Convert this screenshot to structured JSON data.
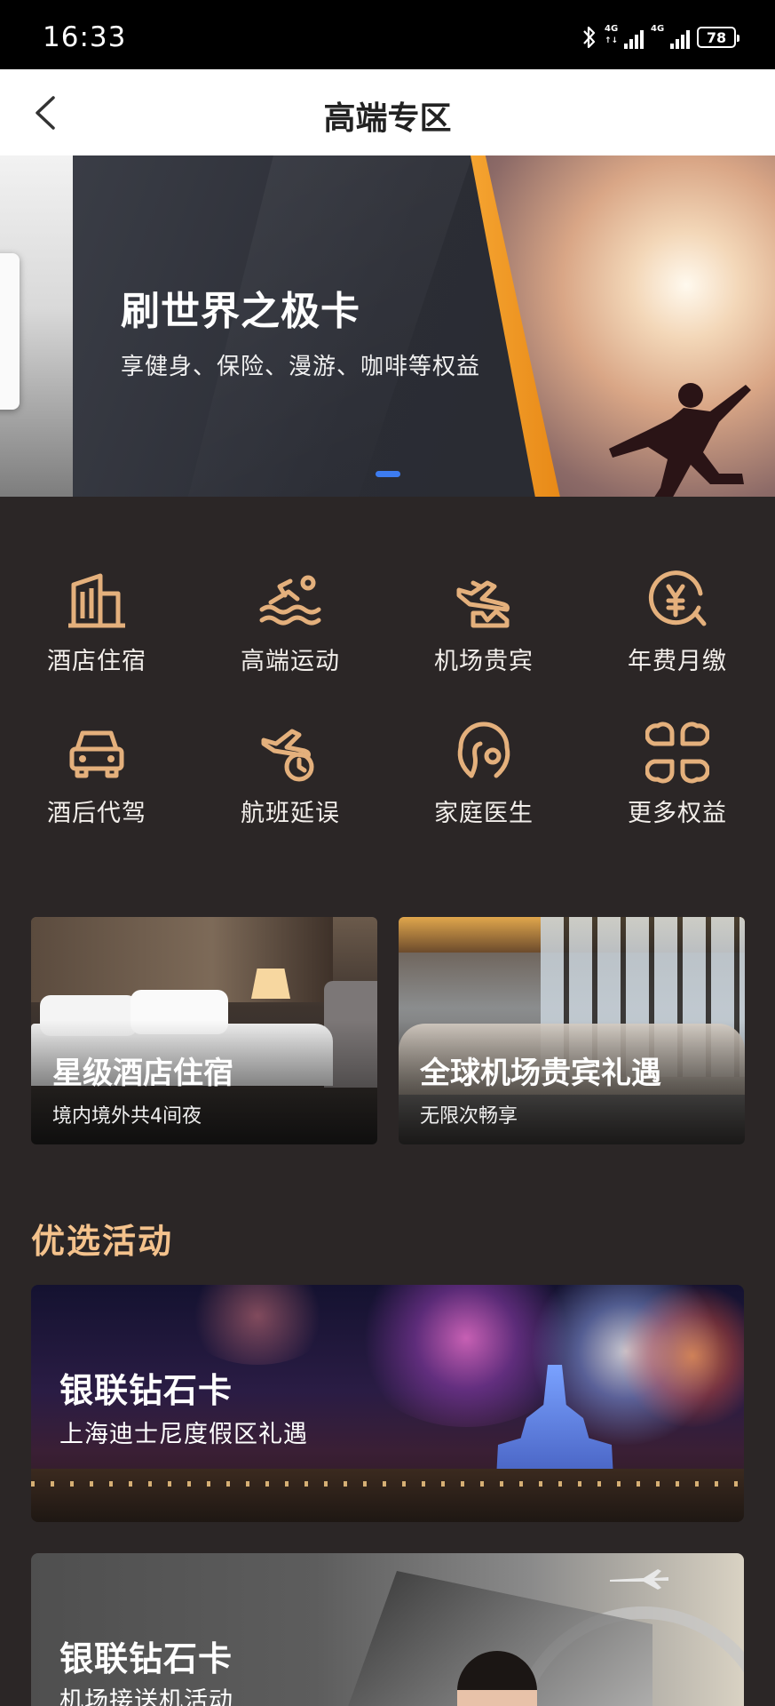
{
  "status_bar": {
    "time": "16:33",
    "network_1": "4G",
    "network_2": "4G",
    "battery": "78"
  },
  "header": {
    "title": "高端专区"
  },
  "banner": {
    "title": "刷世界之极卡",
    "subtitle": "享健身、保险、漫游、咖啡等权益"
  },
  "benefits": [
    {
      "label": "酒店住宿",
      "icon": "building-icon"
    },
    {
      "label": "高端运动",
      "icon": "swimming-icon"
    },
    {
      "label": "机场贵宾",
      "icon": "plane-lounge-icon"
    },
    {
      "label": "年费月缴",
      "icon": "yen-clock-icon"
    },
    {
      "label": "酒后代驾",
      "icon": "car-icon"
    },
    {
      "label": "航班延误",
      "icon": "flight-delay-icon"
    },
    {
      "label": "家庭医生",
      "icon": "stethoscope-icon"
    },
    {
      "label": "更多权益",
      "icon": "more-grid-icon"
    }
  ],
  "feature_cards": [
    {
      "title": "星级酒店住宿",
      "subtitle": "境内境外共4间夜"
    },
    {
      "title": "全球机场贵宾礼遇",
      "subtitle": "无限次畅享"
    }
  ],
  "section": {
    "title": "优选活动"
  },
  "promotions": [
    {
      "title": "银联钻石卡",
      "subtitle": "上海迪士尼度假区礼遇"
    },
    {
      "title": "银联钻石卡",
      "subtitle": "机场接送机活动"
    }
  ],
  "colors": {
    "background": "#2b2626",
    "accent_gold": "#e4b07c",
    "section_title": "#f4c28c",
    "pager_active": "#3d7cf0"
  }
}
